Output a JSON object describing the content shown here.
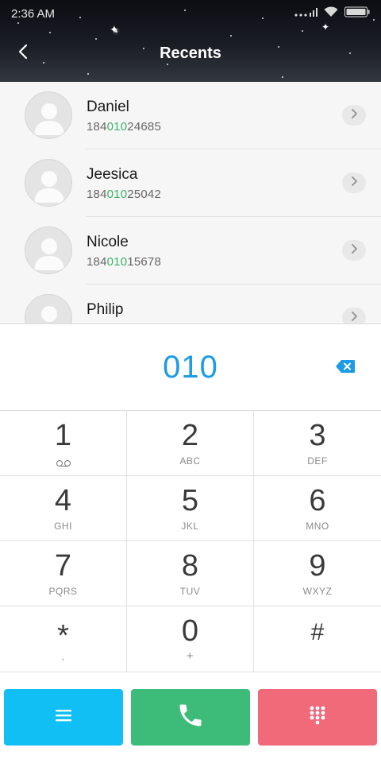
{
  "status_bar": {
    "time": "2:36 AM"
  },
  "header": {
    "title": "Recents"
  },
  "recents": [
    {
      "name": "Daniel",
      "number_prefix": "184",
      "number_match": "010",
      "number_suffix": "24685"
    },
    {
      "name": "Jeesica",
      "number_prefix": "184",
      "number_match": "010",
      "number_suffix": "25042"
    },
    {
      "name": "Nicole",
      "number_prefix": "184",
      "number_match": "010",
      "number_suffix": "15678"
    },
    {
      "name": "Philip",
      "number_prefix": "",
      "number_match": "",
      "number_suffix": ""
    }
  ],
  "dialer": {
    "input": "010"
  },
  "keypad": [
    {
      "digit": "1",
      "letters": ""
    },
    {
      "digit": "2",
      "letters": "ABC"
    },
    {
      "digit": "3",
      "letters": "DEF"
    },
    {
      "digit": "4",
      "letters": "GHI"
    },
    {
      "digit": "5",
      "letters": "JKL"
    },
    {
      "digit": "6",
      "letters": "MNO"
    },
    {
      "digit": "7",
      "letters": "PQRS"
    },
    {
      "digit": "8",
      "letters": "TUV"
    },
    {
      "digit": "9",
      "letters": "WXYZ"
    },
    {
      "digit": "*",
      "letters": ","
    },
    {
      "digit": "0",
      "letters": "+"
    },
    {
      "digit": "#",
      "letters": ""
    }
  ],
  "colors": {
    "accent_blue": "#1c9be6",
    "match_green": "#3bb36b",
    "menu_button": "#12bff4",
    "call_button": "#3dbb79",
    "dialpad_button": "#f06a7a"
  },
  "icons": {
    "back": "chevron-left-icon",
    "detail": "chevron-right-icon",
    "backspace": "backspace-icon",
    "voicemail": "voicemail-icon",
    "menu": "menu-icon",
    "call": "phone-icon",
    "dialpad": "dialpad-icon"
  }
}
